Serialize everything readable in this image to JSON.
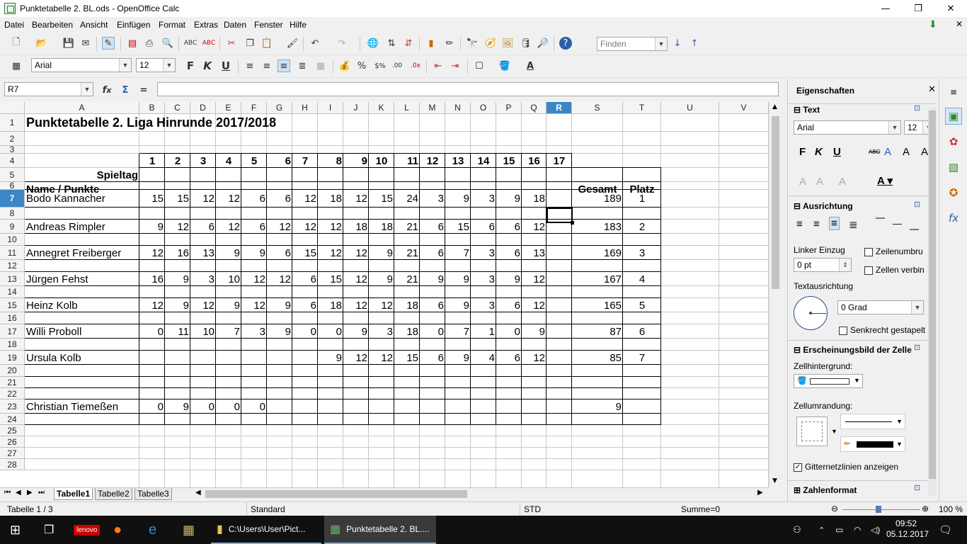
{
  "window": {
    "title": "Punktetabelle 2. BL.ods - OpenOffice Calc",
    "min": "—",
    "max": "❐",
    "close": "✕"
  },
  "menu": [
    "Datei",
    "Bearbeiten",
    "Ansicht",
    "Einfügen",
    "Format",
    "Extras",
    "Daten",
    "Fenster",
    "Hilfe"
  ],
  "toolbar": {
    "find_placeholder": "Finden",
    "font_name": "Arial",
    "font_size": "12"
  },
  "formula": {
    "name_box": "R7",
    "content": ""
  },
  "sheet": {
    "columns": [
      "A",
      "B",
      "C",
      "D",
      "E",
      "F",
      "G",
      "H",
      "I",
      "J",
      "K",
      "L",
      "M",
      "N",
      "O",
      "P",
      "Q",
      "R",
      "S",
      "T",
      "U",
      "V"
    ],
    "rows": [
      "1",
      "2",
      "3",
      "4",
      "5",
      "6",
      "7",
      "8",
      "9",
      "10",
      "11",
      "12",
      "13",
      "14",
      "15",
      "16",
      "17",
      "18",
      "19",
      "20",
      "21",
      "22",
      "23",
      "24",
      "25",
      "26",
      "27",
      "28"
    ],
    "selected_col": "R",
    "selected_row": "7",
    "title": "Punktetabelle 2. Liga Hinrunde 2017/2018",
    "spieltag_label": "Spieltag",
    "spieltage": [
      "1",
      "2",
      "3",
      "4",
      "5",
      "6",
      "7",
      "8",
      "9",
      "10",
      "11",
      "12",
      "13",
      "14",
      "15",
      "16",
      "17"
    ],
    "name_header": "Name / Punkte",
    "gesamt_header": "Gesamt",
    "platz_header": "Platz",
    "players": [
      {
        "name": "Bodo Kannacher",
        "scores": [
          "15",
          "15",
          "12",
          "12",
          "6",
          "6",
          "12",
          "18",
          "12",
          "15",
          "24",
          "3",
          "9",
          "3",
          "9",
          "18"
        ],
        "gesamt": "189",
        "platz": "1"
      },
      {
        "name": "Andreas Rimpler",
        "scores": [
          "9",
          "12",
          "6",
          "12",
          "6",
          "12",
          "12",
          "12",
          "18",
          "18",
          "21",
          "6",
          "15",
          "6",
          "6",
          "12"
        ],
        "gesamt": "183",
        "platz": "2"
      },
      {
        "name": "Annegret Freiberger",
        "scores": [
          "12",
          "16",
          "13",
          "9",
          "9",
          "6",
          "15",
          "12",
          "12",
          "9",
          "21",
          "6",
          "7",
          "3",
          "6",
          "13"
        ],
        "gesamt": "169",
        "platz": "3"
      },
      {
        "name": "Jürgen Fehst",
        "scores": [
          "16",
          "9",
          "3",
          "10",
          "12",
          "12",
          "6",
          "15",
          "12",
          "9",
          "21",
          "9",
          "9",
          "3",
          "9",
          "12"
        ],
        "gesamt": "167",
        "platz": "4"
      },
      {
        "name": "Heinz Kolb",
        "scores": [
          "12",
          "9",
          "12",
          "9",
          "12",
          "9",
          "6",
          "18",
          "12",
          "12",
          "18",
          "6",
          "9",
          "3",
          "6",
          "12"
        ],
        "gesamt": "165",
        "platz": "5"
      },
      {
        "name": "Willi Proboll",
        "scores": [
          "0",
          "11",
          "10",
          "7",
          "3",
          "9",
          "0",
          "0",
          "9",
          "3",
          "18",
          "0",
          "7",
          "1",
          "0",
          "9"
        ],
        "gesamt": "87",
        "platz": "6"
      },
      {
        "name": "Ursula Kolb",
        "scores": [
          "",
          "",
          "",
          "",
          "",
          "",
          "",
          "9",
          "12",
          "12",
          "15",
          "6",
          "9",
          "4",
          "6",
          "12"
        ],
        "gesamt": "85",
        "platz": "7"
      },
      {
        "name": "Christian Tiemeßen",
        "scores": [
          "0",
          "9",
          "0",
          "0",
          "0",
          "",
          "",
          "",
          "",
          "",
          "",
          "",
          "",
          "",
          "",
          ""
        ],
        "gesamt": "9",
        "platz": ""
      }
    ]
  },
  "tabs": [
    "Tabelle1",
    "Tabelle2",
    "Tabelle3"
  ],
  "status": {
    "sheet": "Tabelle 1 / 3",
    "style": "Standard",
    "mode": "STD",
    "sum": "Summe=0",
    "zoom": "100 %"
  },
  "sidebar": {
    "title": "Eigenschaften",
    "text_section": "Text",
    "font_name": "Arial",
    "font_size": "12",
    "align_section": "Ausrichtung",
    "indent_label": "Linker Einzug",
    "indent_value": "0 pt",
    "wrap_label": "Zeilenumbru",
    "merge_label": "Zellen verbin",
    "orientation_label": "Textausrichtung",
    "degree_value": "0 Grad",
    "stacked_label": "Senkrecht gestapelt",
    "appearance_section": "Erscheinungsbild der Zelle",
    "bg_label": "Zellhintergrund:",
    "border_label": "Zellumrandung:",
    "grid_label": "Gitternetzlinien anzeigen",
    "number_section": "Zahlenformat"
  },
  "taskbar": {
    "explorer": "C:\\Users\\User\\Pict...",
    "calc": "Punktetabelle 2. BL....",
    "time": "09:52",
    "date": "05.12.2017"
  }
}
